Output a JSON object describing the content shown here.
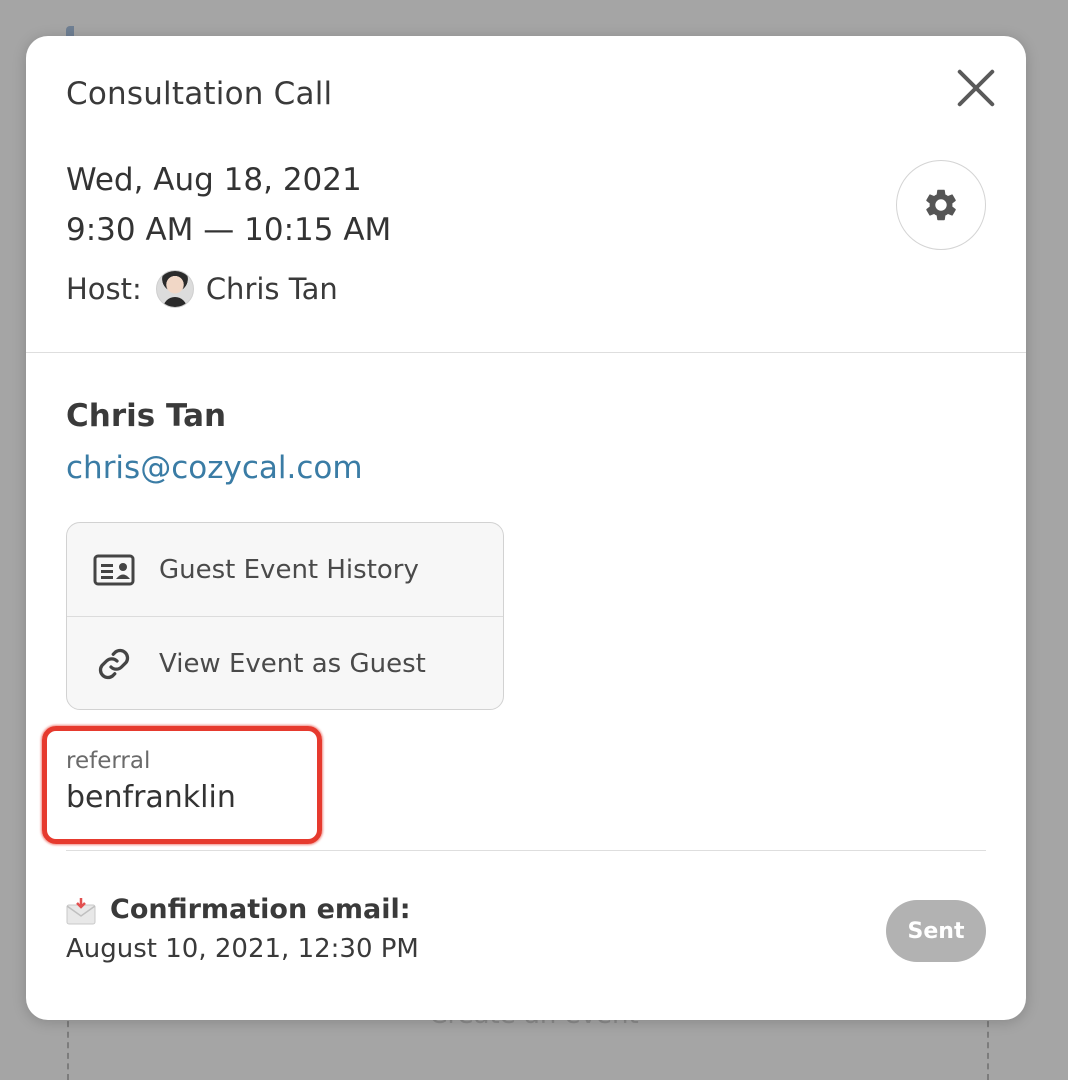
{
  "modal": {
    "title": "Consultation Call",
    "date": "Wed, Aug 18, 2021",
    "time": "9:30 AM — 10:15 AM",
    "host_label": "Host:",
    "host_name": "Chris Tan"
  },
  "guest": {
    "name": "Chris Tan",
    "email": "chris@cozycal.com"
  },
  "actions": [
    {
      "label": "Guest Event History",
      "icon": "contact-card-icon"
    },
    {
      "label": "View Event as Guest",
      "icon": "link-icon"
    }
  ],
  "custom_field": {
    "label": "referral",
    "value": "benfranklin"
  },
  "confirmation": {
    "label": "Confirmation email:",
    "date": "August 10, 2021, 12:30 PM",
    "status": "Sent"
  },
  "background": {
    "create_label": "Create an event"
  },
  "colors": {
    "link": "#3a7ca5",
    "highlight": "#e63a2e",
    "sent_badge": "#b2b2b2"
  }
}
